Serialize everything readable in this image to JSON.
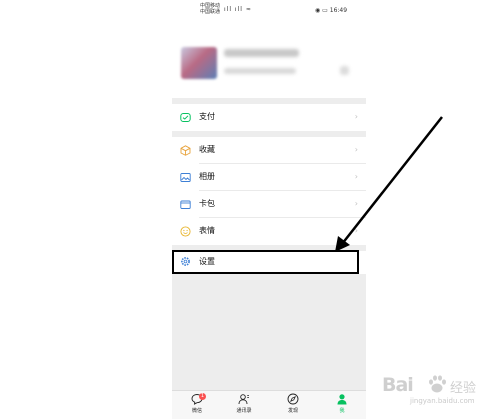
{
  "status_bar": {
    "carrier_line1": "中国移动",
    "carrier_line2": "中国联通",
    "signal": "ıll ıll",
    "time": "16:49"
  },
  "menu": {
    "pay": "支付",
    "favorites": "收藏",
    "album": "相册",
    "cards": "卡包",
    "stickers": "表情",
    "settings": "设置"
  },
  "tabbar": {
    "chats": "微信",
    "chats_badge": "1",
    "contacts": "通讯录",
    "discover": "发现",
    "me": "我"
  },
  "watermark": {
    "brand": "Bai",
    "brand_cn": "经验",
    "url": "jingyan.baidu.com"
  },
  "colors": {
    "accent": "#07c160",
    "badge": "#fa5151",
    "page_bg": "#ededed"
  }
}
